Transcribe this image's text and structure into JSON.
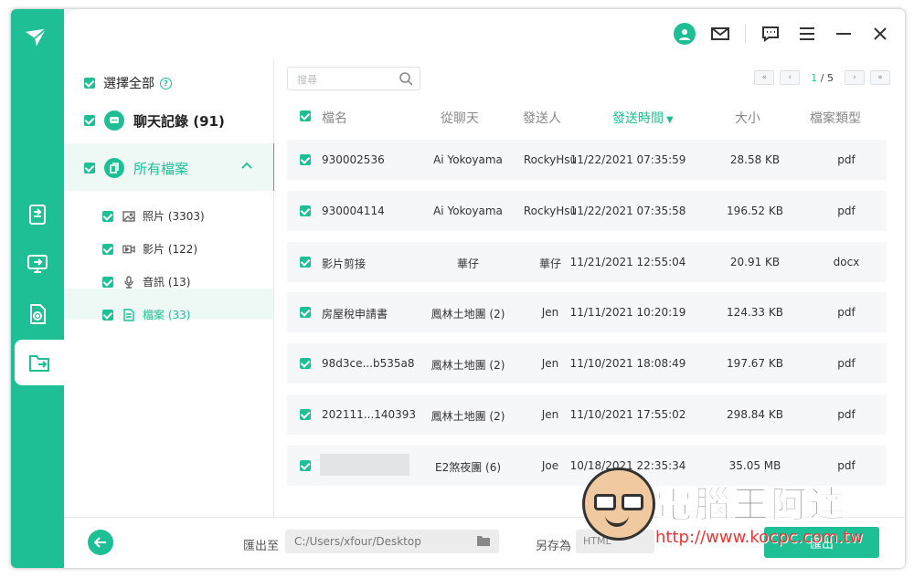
{
  "sidebar": {
    "nav_icons": [
      "chat-transfer-icon",
      "device-transfer-icon",
      "backup-icon",
      "export-icon"
    ],
    "active": "export-icon"
  },
  "header": {
    "icons": [
      "user-avatar-icon",
      "mail-icon",
      "feedback-icon",
      "menu-icon",
      "minimize-icon",
      "close-icon"
    ]
  },
  "categories": {
    "select_all": "選擇全部",
    "chat_history": "聊天記錄 (91)",
    "all_files": "所有檔案",
    "items": [
      {
        "label": "照片 (3303)",
        "icon": "image-icon"
      },
      {
        "label": "影片 (122)",
        "icon": "video-icon"
      },
      {
        "label": "音訊 (13)",
        "icon": "microphone-icon"
      },
      {
        "label": "檔案 (33)",
        "icon": "document-icon"
      }
    ],
    "active_item": "檔案 (33)"
  },
  "search": {
    "placeholder": "搜尋"
  },
  "pager": {
    "current": "1",
    "total": "/ 5"
  },
  "table": {
    "columns": [
      "檔名",
      "從聊天",
      "發送人",
      "發送時間",
      "大小",
      "檔案類型"
    ],
    "sorted_column": "發送時間",
    "rows": [
      {
        "name": "930002536",
        "chat": "Ai Yokoyama",
        "sender": "RockyHsu",
        "time": "11/22/2021 07:35:59",
        "size": "28.58 KB",
        "type": "pdf"
      },
      {
        "name": "930004114",
        "chat": "Ai Yokoyama",
        "sender": "RockyHsu",
        "time": "11/22/2021 07:35:58",
        "size": "196.52 KB",
        "type": "pdf"
      },
      {
        "name": "影片剪接",
        "chat": "華仔",
        "sender": "華仔",
        "time": "11/21/2021 12:55:04",
        "size": "20.91 KB",
        "type": "docx"
      },
      {
        "name": "房屋稅申請書",
        "chat": "鳳林土地團 (2)",
        "sender": "Jen",
        "time": "11/11/2021 10:20:19",
        "size": "124.33 KB",
        "type": "pdf"
      },
      {
        "name": "98d3ce...b535a8",
        "chat": "鳳林土地團 (2)",
        "sender": "Jen",
        "time": "11/10/2021 18:08:49",
        "size": "197.67 KB",
        "type": "pdf"
      },
      {
        "name": "202111...140393",
        "chat": "鳳林土地團 (2)",
        "sender": "Jen",
        "time": "11/10/2021 17:55:02",
        "size": "298.84 KB",
        "type": "pdf"
      },
      {
        "name": "",
        "chat": "E2煞夜團 (6)",
        "sender": "Joe",
        "time": "10/18/2021 22:35:34",
        "size": "35.05 MB",
        "type": "pdf"
      }
    ]
  },
  "footer": {
    "export_to_label": "匯出至",
    "path": "C:/Users/xfour/Desktop",
    "save_as_label": "另存為",
    "format": "HTML",
    "export_button": "匯出"
  },
  "watermark": {
    "brand": "電腦王阿達",
    "url": "http://www.kocpc.com.tw"
  },
  "colors": {
    "accent": "#1fbf95"
  }
}
